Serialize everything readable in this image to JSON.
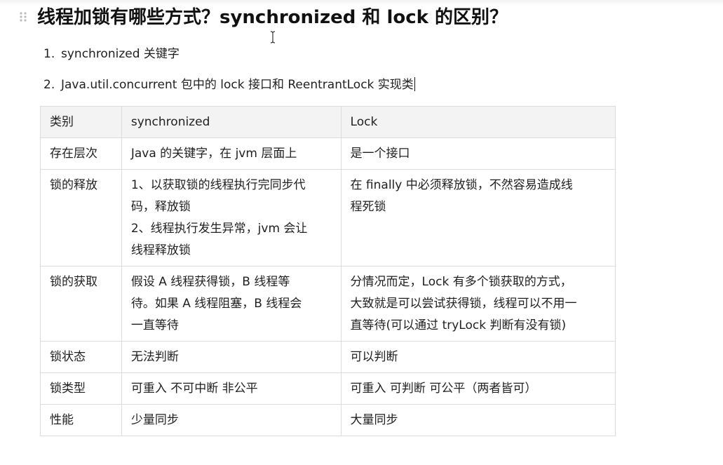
{
  "title": "线程加锁有哪些方式？synchronized 和 lock 的区别？",
  "list": [
    {
      "num": "1.",
      "text": "synchronized 关键字"
    },
    {
      "num": "2.",
      "text": "Java.util.concurrent 包中的 lock 接口和 ReentrantLock 实现类"
    }
  ],
  "table": {
    "headers": [
      "类别",
      "synchronized",
      "Lock"
    ],
    "rows": [
      {
        "category": "存在层次",
        "sync": [
          "Java 的关键字，在 jvm 层面上"
        ],
        "lock": [
          "是一个接口"
        ]
      },
      {
        "category": "锁的释放",
        "sync": [
          "1、以获取锁的线程执行完同步代",
          "码，释放锁",
          "2、线程执行发生异常，jvm 会让",
          "线程释放锁"
        ],
        "lock": [
          "在 finally 中必须释放锁，不然容易造成线",
          "程死锁"
        ]
      },
      {
        "category": "锁的获取",
        "sync": [
          "假设 A 线程获得锁，B 线程等",
          "待。如果 A 线程阻塞，B 线程会",
          "一直等待"
        ],
        "lock": [
          "分情况而定，Lock 有多个锁获取的方式，",
          "大致就是可以尝试获得锁，线程可以不用一",
          "直等待(可以通过 tryLock 判断有没有锁)"
        ]
      },
      {
        "category": "锁状态",
        "sync": [
          "无法判断"
        ],
        "lock": [
          "可以判断"
        ]
      },
      {
        "category": "锁类型",
        "sync": [
          "可重入 不可中断 非公平"
        ],
        "lock": [
          "可重入 可判断 可公平（两者皆可）"
        ]
      },
      {
        "category": "性能",
        "sync": [
          "少量同步"
        ],
        "lock": [
          "大量同步"
        ]
      }
    ]
  }
}
